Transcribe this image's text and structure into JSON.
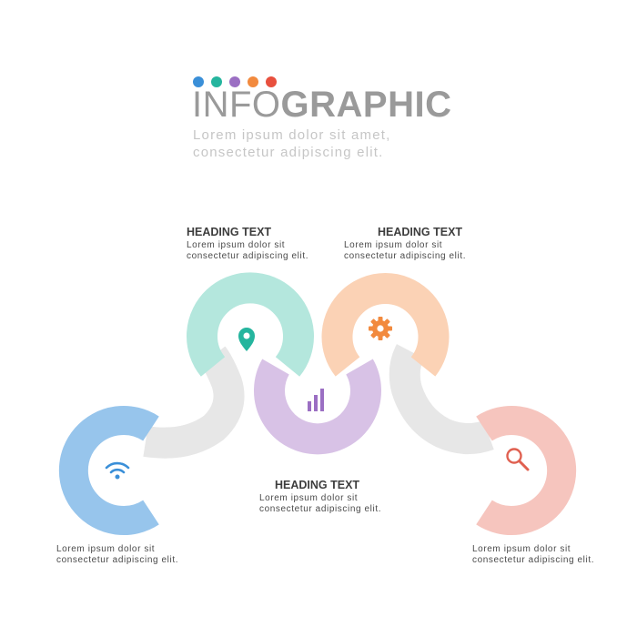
{
  "header": {
    "dot_colors": [
      "#3a8fd8",
      "#25b59e",
      "#9b6fc3",
      "#f28a3e",
      "#e8503e"
    ],
    "title_light": "INFO",
    "title_bold": "GRAPHIC",
    "subtitle_line1": "Lorem ipsum dolor sit amet,",
    "subtitle_line2": "consectetur adipiscing elit."
  },
  "steps": [
    {
      "id": "wifi",
      "icon": "wifi-icon",
      "ring_color": "#97c5ec",
      "icon_color": "#3a8fd8",
      "heading": "",
      "body_line1": "Lorem ipsum dolor sit",
      "body_line2": "consectetur adipiscing elit."
    },
    {
      "id": "location",
      "icon": "location-pin-icon",
      "ring_color": "#b4e7dd",
      "icon_color": "#25b59e",
      "heading": "HEADING TEXT",
      "body_line1": "Lorem ipsum dolor sit",
      "body_line2": "consectetur adipiscing elit."
    },
    {
      "id": "chart",
      "icon": "bar-chart-icon",
      "ring_color": "#d8c2e6",
      "icon_color": "#9b6fc3",
      "heading": "HEADING TEXT",
      "body_line1": "Lorem ipsum dolor sit",
      "body_line2": "consectetur adipiscing elit."
    },
    {
      "id": "gear",
      "icon": "gear-icon",
      "ring_color": "#fbd2b5",
      "icon_color": "#f28a3e",
      "heading": "HEADING TEXT",
      "body_line1": "Lorem ipsum dolor sit",
      "body_line2": "consectetur adipiscing elit."
    },
    {
      "id": "search",
      "icon": "magnifier-icon",
      "ring_color": "#f6c5be",
      "icon_color": "#e06050",
      "heading": "",
      "body_line1": "Lorem ipsum dolor sit",
      "body_line2": "consectetur adipiscing elit."
    }
  ],
  "connector_color": "#e7e7e7"
}
